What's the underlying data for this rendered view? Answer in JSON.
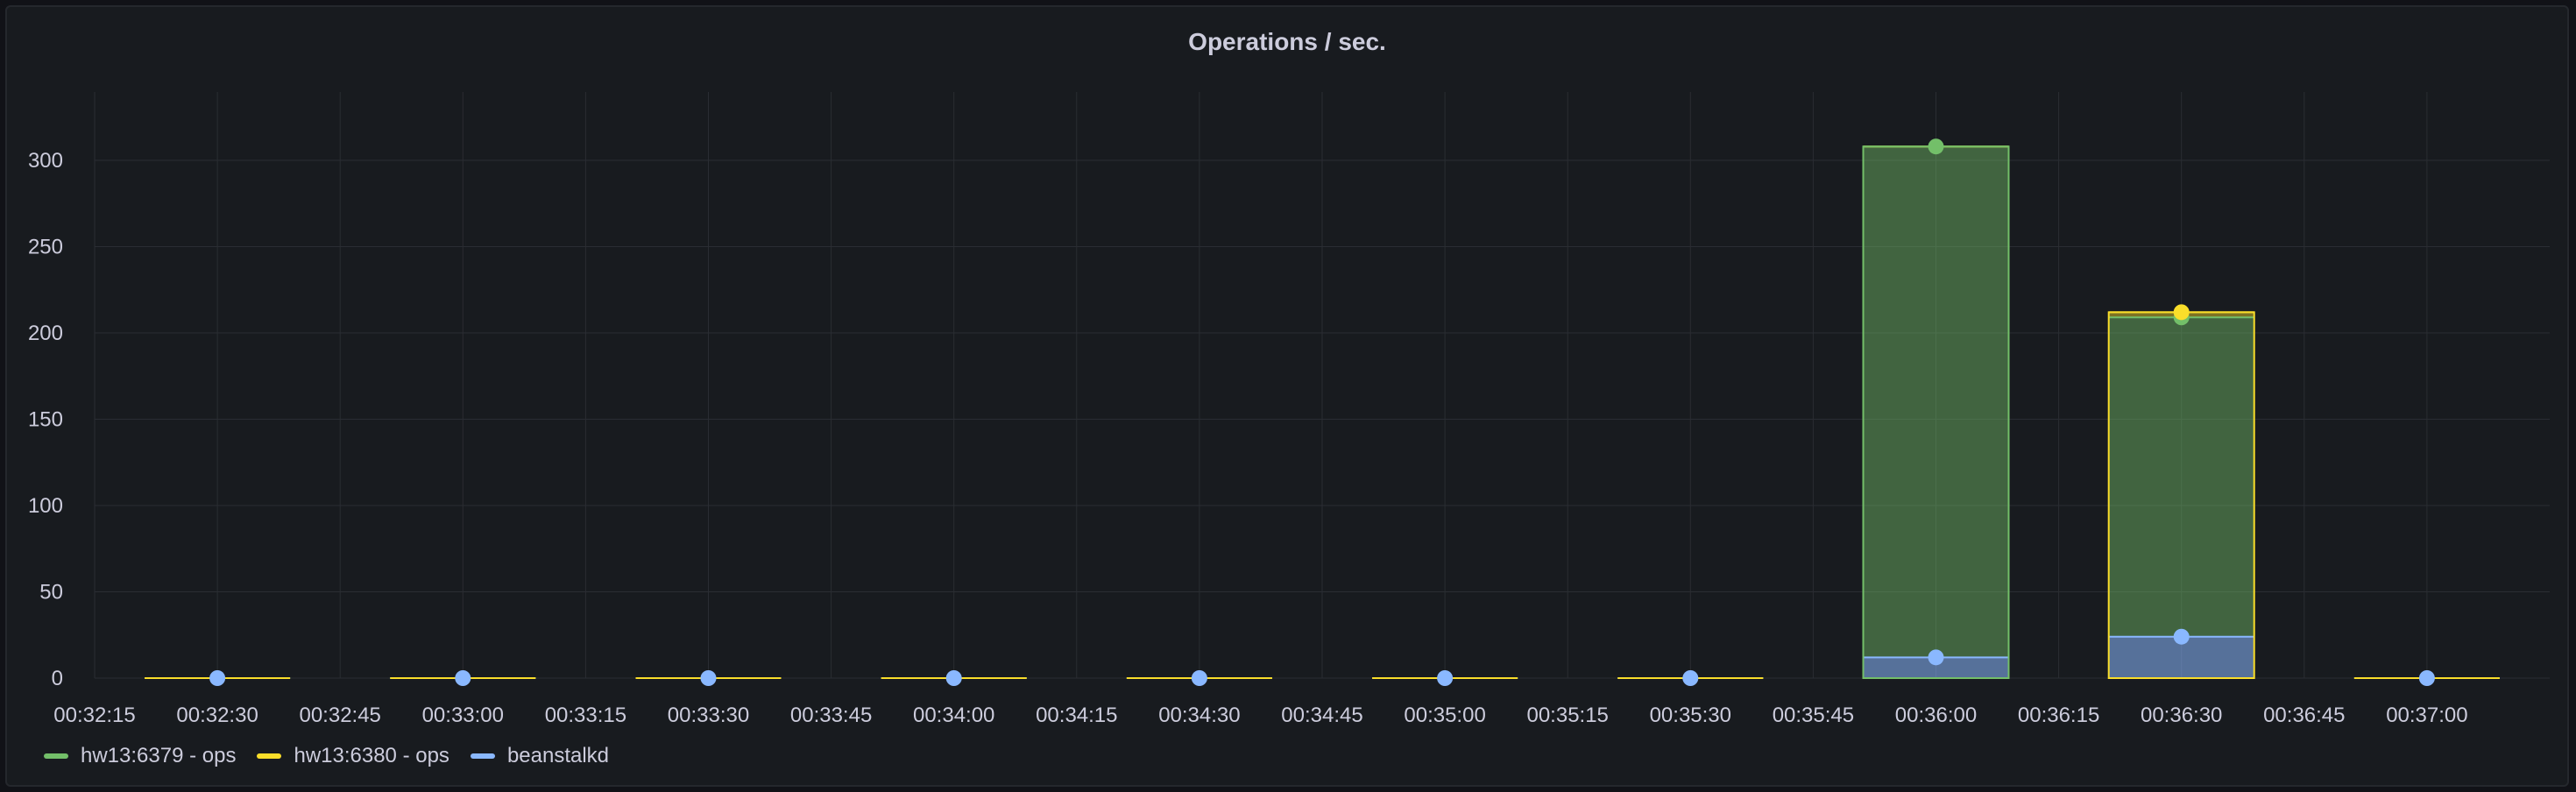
{
  "panel": {
    "title": "Operations / sec."
  },
  "colors": {
    "green": "#73bf69",
    "yellow": "#fade2a",
    "blue": "#8ab8ff",
    "grid": "#2a2d33",
    "text": "#ccccdc"
  },
  "legend": [
    {
      "label": "hw13:6379 - ops",
      "color": "#73bf69"
    },
    {
      "label": "hw13:6380 - ops",
      "color": "#fade2a"
    },
    {
      "label": "beanstalkd",
      "color": "#8ab8ff"
    }
  ],
  "chart_data": {
    "type": "bar",
    "stacked": true,
    "title": "Operations / sec.",
    "xlabel": "",
    "ylabel": "",
    "ylim": [
      0,
      340
    ],
    "yticks": [
      0,
      50,
      100,
      150,
      200,
      250,
      300
    ],
    "xticks": [
      "00:32:15",
      "00:32:30",
      "00:32:45",
      "00:33:00",
      "00:33:15",
      "00:33:30",
      "00:33:45",
      "00:34:00",
      "00:34:15",
      "00:34:30",
      "00:34:45",
      "00:35:00",
      "00:35:15",
      "00:35:30",
      "00:35:45",
      "00:36:00",
      "00:36:15",
      "00:36:30",
      "00:36:45",
      "00:37:00"
    ],
    "categories": [
      "00:32:30",
      "00:33:00",
      "00:33:30",
      "00:34:00",
      "00:34:30",
      "00:35:00",
      "00:35:30",
      "00:36:00",
      "00:36:30",
      "00:37:00"
    ],
    "series": [
      {
        "name": "beanstalkd",
        "color": "#8ab8ff",
        "values": [
          0,
          0,
          0,
          0,
          0,
          0,
          0,
          12,
          24,
          0
        ]
      },
      {
        "name": "hw13:6379 - ops",
        "color": "#73bf69",
        "values": [
          0,
          0,
          0,
          0,
          0,
          0,
          0,
          296,
          185,
          0
        ]
      },
      {
        "name": "hw13:6380 - ops",
        "color": "#fade2a",
        "values": [
          0,
          0,
          0,
          0,
          0,
          0,
          0,
          0,
          3,
          0
        ]
      }
    ],
    "grid": true,
    "legend_position": "bottom-left"
  }
}
